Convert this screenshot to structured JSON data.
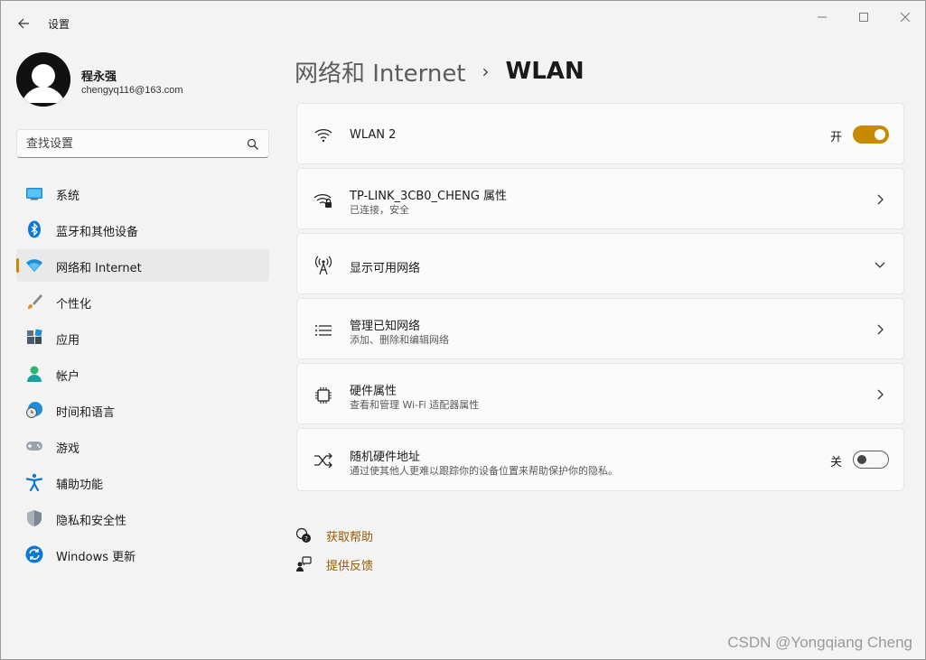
{
  "window": {
    "app_title": "设置"
  },
  "profile": {
    "name": "程永强",
    "email": "chengyq116@163.com"
  },
  "search": {
    "placeholder": "查找设置"
  },
  "sidebar": {
    "items": [
      {
        "label": "系统",
        "icon": "system-icon"
      },
      {
        "label": "蓝牙和其他设备",
        "icon": "bluetooth-icon"
      },
      {
        "label": "网络和 Internet",
        "icon": "wifi-icon",
        "active": true
      },
      {
        "label": "个性化",
        "icon": "brush-icon"
      },
      {
        "label": "应用",
        "icon": "apps-icon"
      },
      {
        "label": "帐户",
        "icon": "account-icon"
      },
      {
        "label": "时间和语言",
        "icon": "globe-clock-icon"
      },
      {
        "label": "游戏",
        "icon": "gamepad-icon"
      },
      {
        "label": "辅助功能",
        "icon": "accessibility-icon"
      },
      {
        "label": "隐私和安全性",
        "icon": "shield-icon"
      },
      {
        "label": "Windows 更新",
        "icon": "update-icon"
      }
    ]
  },
  "breadcrumb": {
    "parent": "网络和 Internet",
    "separator": "›",
    "current": "WLAN"
  },
  "cards": {
    "wlan": {
      "title": "WLAN 2",
      "toggle_label": "开",
      "toggle_on": true
    },
    "properties": {
      "title": "TP-LINK_3CB0_CHENG 属性",
      "subtitle": "已连接，安全"
    },
    "available": {
      "title": "显示可用网络"
    },
    "known": {
      "title": "管理已知网络",
      "subtitle": "添加、删除和编辑网络"
    },
    "hardware": {
      "title": "硬件属性",
      "subtitle": "查看和管理 Wi-Fi 适配器属性"
    },
    "random_mac": {
      "title": "随机硬件地址",
      "subtitle": "通过使其他人更难以跟踪你的设备位置来帮助保护你的隐私。",
      "toggle_label": "关",
      "toggle_on": false
    }
  },
  "help": {
    "get_help": "获取帮助",
    "feedback": "提供反馈"
  },
  "watermark": "CSDN @Yongqiang Cheng",
  "colors": {
    "accent": "#c88a00",
    "link": "#9a5a00",
    "background": "#f3f3f3",
    "card": "#fbfbfb"
  }
}
